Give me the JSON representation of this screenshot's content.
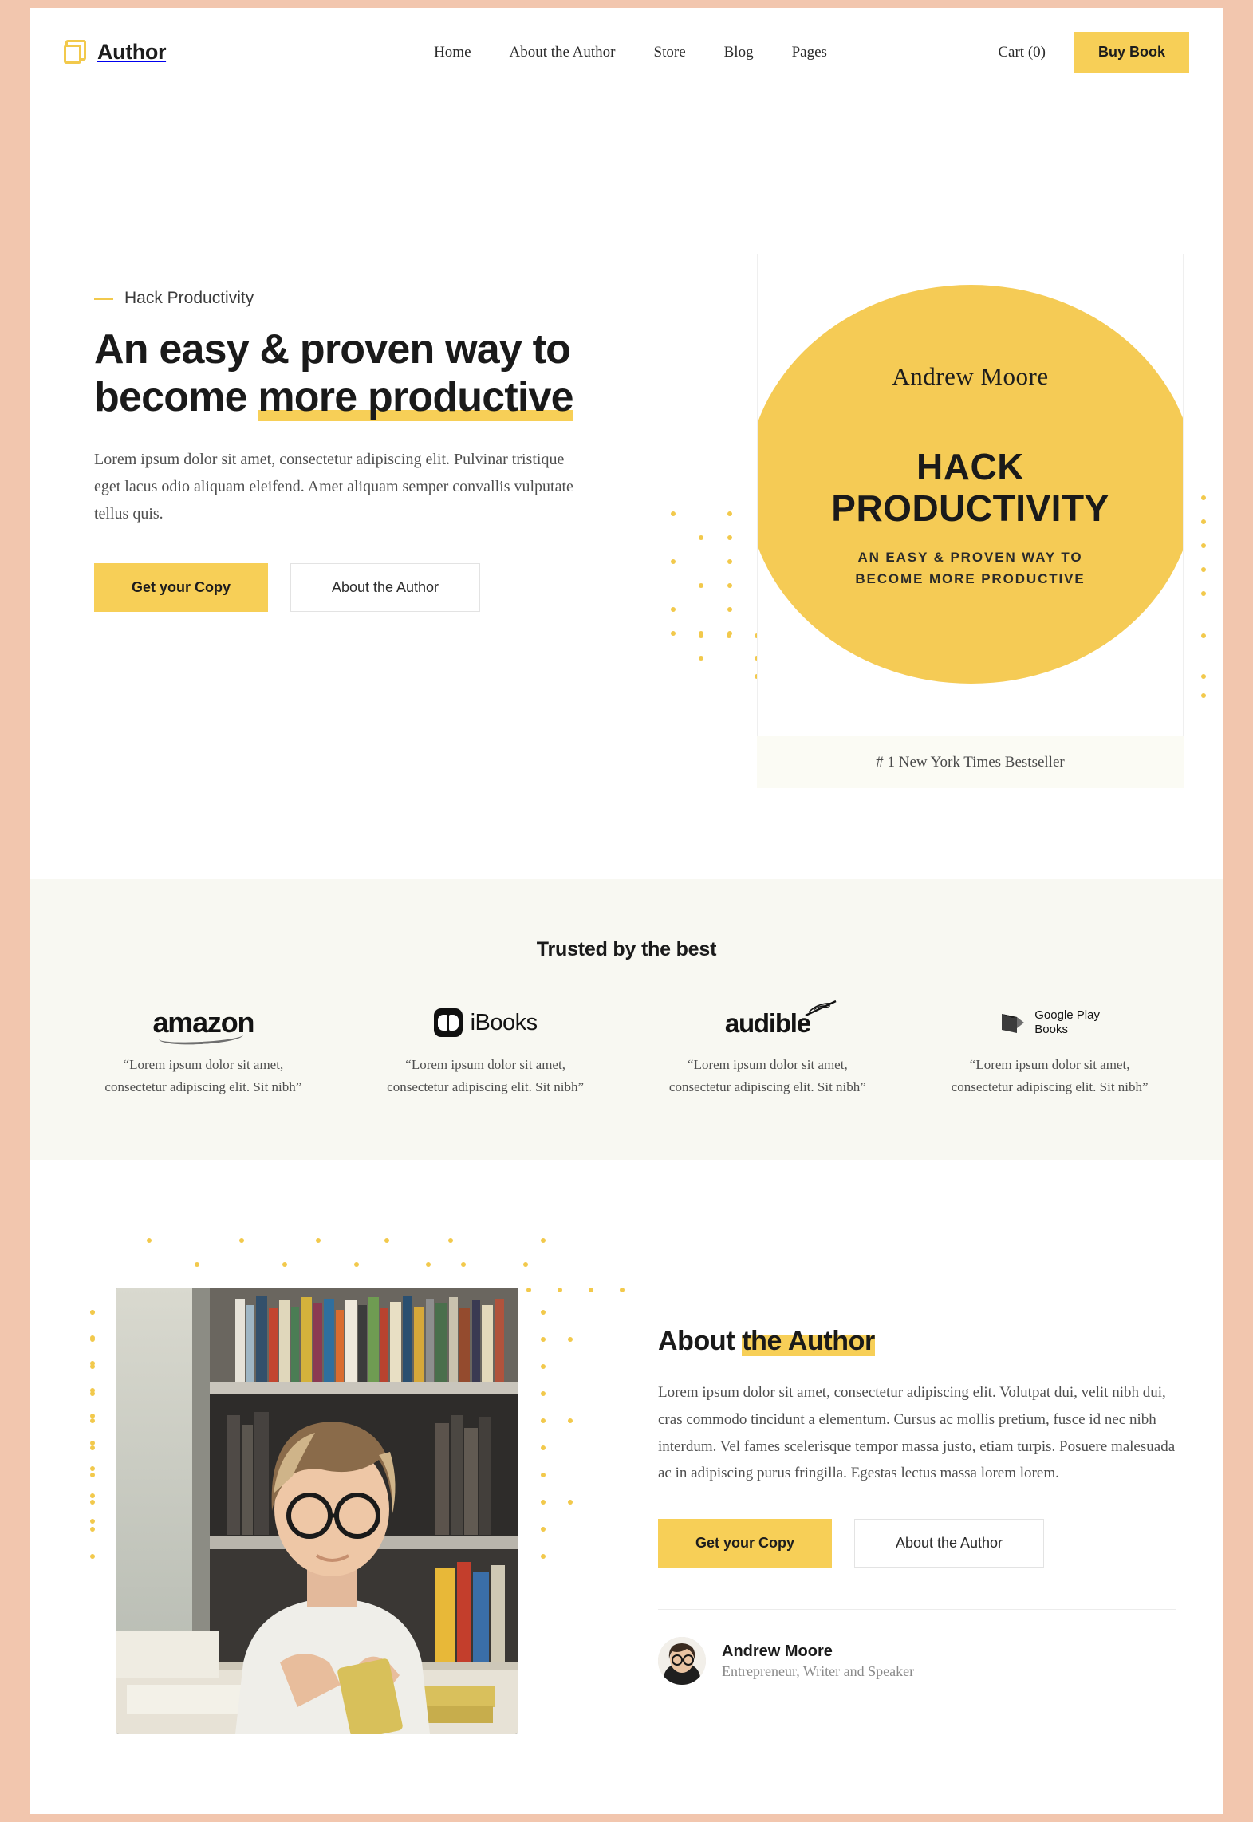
{
  "header": {
    "brand": "Author",
    "nav": [
      {
        "label": "Home"
      },
      {
        "label": "About the Author"
      },
      {
        "label": "Store"
      },
      {
        "label": "Blog"
      },
      {
        "label": "Pages"
      }
    ],
    "cart": "Cart (0)",
    "buy_button": "Buy Book"
  },
  "hero": {
    "eyebrow": "Hack Productivity",
    "title_line1": "An easy & proven way to",
    "title_line2_plain": "become ",
    "title_line2_highlight": "more productive",
    "paragraph": "Lorem ipsum dolor sit amet, consectetur adipiscing elit. Pulvinar tristique eget lacus odio aliquam eleifend. Amet aliquam semper convallis vulputate tellus quis.",
    "primary_button": "Get your Copy",
    "secondary_button": "About the Author",
    "book": {
      "author": "Andrew Moore",
      "title_line1": "HACK",
      "title_line2": "PRODUCTIVITY",
      "subtitle_line1": "AN EASY & PROVEN WAY TO",
      "subtitle_line2": "BECOME MORE PRODUCTIVE",
      "badge": "# 1 New York Times Bestseller"
    }
  },
  "trusted": {
    "heading": "Trusted by the best",
    "brands": [
      {
        "name": "amazon",
        "logo": "amazon-logo",
        "quote_line1": "“Lorem ipsum dolor sit amet,",
        "quote_line2": "consectetur adipiscing elit. Sit nibh”"
      },
      {
        "name": "iBooks",
        "logo": "ibooks-logo",
        "quote_line1": "“Lorem ipsum dolor sit amet,",
        "quote_line2": "consectetur adipiscing elit. Sit nibh”"
      },
      {
        "name": "audible",
        "logo": "audible-logo",
        "quote_line1": "“Lorem ipsum dolor sit amet,",
        "quote_line2": "consectetur adipiscing elit. Sit nibh”"
      },
      {
        "name": "Google Play Books",
        "logo": "google-play-books-logo",
        "name_line1": "Google Play",
        "name_line2": "Books",
        "quote_line1": "“Lorem ipsum dolor sit amet,",
        "quote_line2": "consectetur adipiscing elit. Sit nibh”"
      }
    ]
  },
  "about": {
    "title_plain": "About ",
    "title_highlight": "the Author",
    "paragraph": "Lorem ipsum dolor sit amet, consectetur adipiscing elit. Volutpat dui, velit nibh dui, cras commodo tincidunt a elementum. Cursus ac mollis pretium, fusce id nec nibh interdum. Vel fames scelerisque tempor massa justo, etiam turpis. Posuere malesuada ac in adipiscing purus fringilla. Egestas lectus massa lorem lorem.",
    "primary_button": "Get your Copy",
    "secondary_button": "About the Author",
    "author_name": "Andrew Moore",
    "author_role": "Entrepreneur, Writer and Speaker"
  },
  "colors": {
    "accent": "#f7cf57",
    "accent_deep": "#f5cb55",
    "page_border": "#f2c6ae",
    "trusted_bg": "#f8f8f2",
    "badge_bg": "#fbfbf4"
  }
}
